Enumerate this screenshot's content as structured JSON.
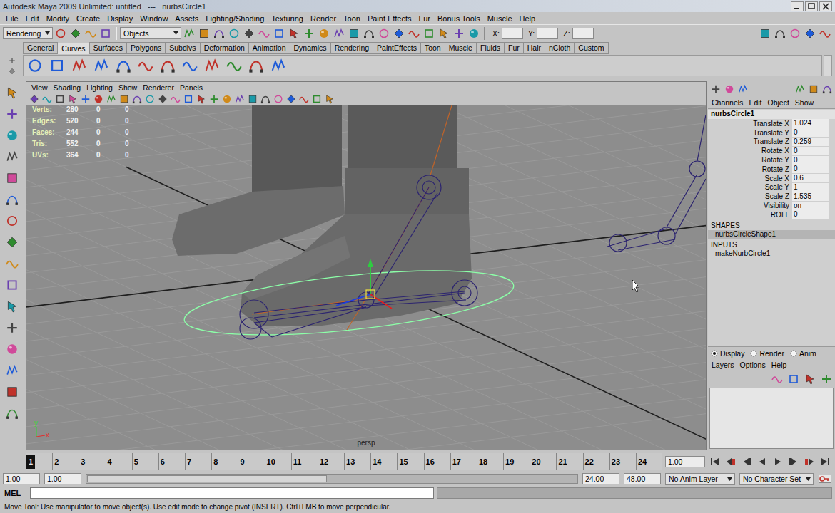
{
  "window": {
    "title": "Autodesk Maya 2009 Unlimited: untitled   ---   nurbsCircle1"
  },
  "menu_bar": [
    "File",
    "Edit",
    "Modify",
    "Create",
    "Display",
    "Window",
    "Assets",
    "Lighting/Shading",
    "Texturing",
    "Render",
    "Toon",
    "Paint Effects",
    "Fur",
    "Bonus Tools",
    "Muscle",
    "Help"
  ],
  "status_line": {
    "menu_set": "Rendering",
    "selection_mode": "Objects",
    "coord_labels": [
      "X:",
      "Y:",
      "Z:"
    ]
  },
  "shelf": {
    "tabs": [
      {
        "label": "General",
        "selected": false
      },
      {
        "label": "Curves",
        "selected": true
      },
      {
        "label": "Surfaces",
        "selected": false
      },
      {
        "label": "Polygons",
        "selected": false
      },
      {
        "label": "Subdivs",
        "selected": false
      },
      {
        "label": "Deformation",
        "selected": false
      },
      {
        "label": "Animation",
        "selected": false
      },
      {
        "label": "Dynamics",
        "selected": false
      },
      {
        "label": "Rendering",
        "selected": false
      },
      {
        "label": "PaintEffects",
        "selected": false
      },
      {
        "label": "Toon",
        "selected": false
      },
      {
        "label": "Muscle",
        "selected": false
      },
      {
        "label": "Fluids",
        "selected": false
      },
      {
        "label": "Fur",
        "selected": false
      },
      {
        "label": "Hair",
        "selected": false
      },
      {
        "label": "nCloth",
        "selected": false
      },
      {
        "label": "Custom",
        "selected": false
      }
    ]
  },
  "panel": {
    "menu": [
      "View",
      "Shading",
      "Lighting",
      "Show",
      "Renderer",
      "Panels"
    ],
    "hud": [
      {
        "label": "Verts:",
        "values": [
          "280",
          "0",
          "0"
        ]
      },
      {
        "label": "Edges:",
        "values": [
          "520",
          "0",
          "0"
        ]
      },
      {
        "label": "Faces:",
        "values": [
          "244",
          "0",
          "0"
        ]
      },
      {
        "label": "Tris:",
        "values": [
          "552",
          "0",
          "0"
        ]
      },
      {
        "label": "UVs:",
        "values": [
          "364",
          "0",
          "0"
        ]
      }
    ],
    "camera": "persp",
    "axis_labels": [
      "y",
      "x"
    ]
  },
  "channel_box": {
    "menu": [
      "Channels",
      "Edit",
      "Object",
      "Show"
    ],
    "node": "nurbsCircle1",
    "attributes": [
      {
        "label": "Translate X",
        "value": "1.024"
      },
      {
        "label": "Translate Y",
        "value": "0"
      },
      {
        "label": "Translate Z",
        "value": "0.259"
      },
      {
        "label": "Rotate X",
        "value": "0"
      },
      {
        "label": "Rotate Y",
        "value": "0"
      },
      {
        "label": "Rotate Z",
        "value": "0"
      },
      {
        "label": "Scale X",
        "value": "0.6"
      },
      {
        "label": "Scale Y",
        "value": "1"
      },
      {
        "label": "Scale Z",
        "value": "1.535"
      },
      {
        "label": "Visibility",
        "value": "on"
      },
      {
        "label": "ROLL",
        "value": "0"
      }
    ],
    "shapes_header": "SHAPES",
    "shapes": [
      {
        "label": "nurbsCircleShape1",
        "selected": true
      }
    ],
    "inputs_header": "INPUTS",
    "inputs": [
      {
        "label": "makeNurbCircle1",
        "selected": false
      }
    ]
  },
  "layer_editor": {
    "modes": [
      {
        "label": "Display",
        "selected": true
      },
      {
        "label": "Render",
        "selected": false
      },
      {
        "label": "Anim",
        "selected": false
      }
    ],
    "menu": [
      "Layers",
      "Options",
      "Help"
    ]
  },
  "time_slider": {
    "frames": [
      {
        "label": "1",
        "selected": true
      },
      {
        "label": "2",
        "selected": false
      },
      {
        "label": "3",
        "selected": false
      },
      {
        "label": "4",
        "selected": false
      },
      {
        "label": "5",
        "selected": false
      },
      {
        "label": "6",
        "selected": false
      },
      {
        "label": "7",
        "selected": false
      },
      {
        "label": "8",
        "selected": false
      },
      {
        "label": "9",
        "selected": false
      },
      {
        "label": "10",
        "selected": false
      },
      {
        "label": "11",
        "selected": false
      },
      {
        "label": "12",
        "selected": false
      },
      {
        "label": "13",
        "selected": false
      },
      {
        "label": "14",
        "selected": false
      },
      {
        "label": "15",
        "selected": false
      },
      {
        "label": "16",
        "selected": false
      },
      {
        "label": "17",
        "selected": false
      },
      {
        "label": "18",
        "selected": false
      },
      {
        "label": "19",
        "selected": false
      },
      {
        "label": "20",
        "selected": false
      },
      {
        "label": "21",
        "selected": false
      },
      {
        "label": "22",
        "selected": false
      },
      {
        "label": "23",
        "selected": false
      },
      {
        "label": "24",
        "selected": false
      }
    ],
    "current_time": "1.00"
  },
  "range_slider": {
    "start": "1.00",
    "range_start": "1.00",
    "range_end": "24.00",
    "end": "48.00",
    "anim_layer": "No Anim Layer",
    "character_set": "No Character Set"
  },
  "command_line": {
    "language": "MEL"
  },
  "help_line": "Move Tool: Use manipulator to move object(s). Use edit mode to change pivot (INSERT). Ctrl+LMB to move perpendicular."
}
